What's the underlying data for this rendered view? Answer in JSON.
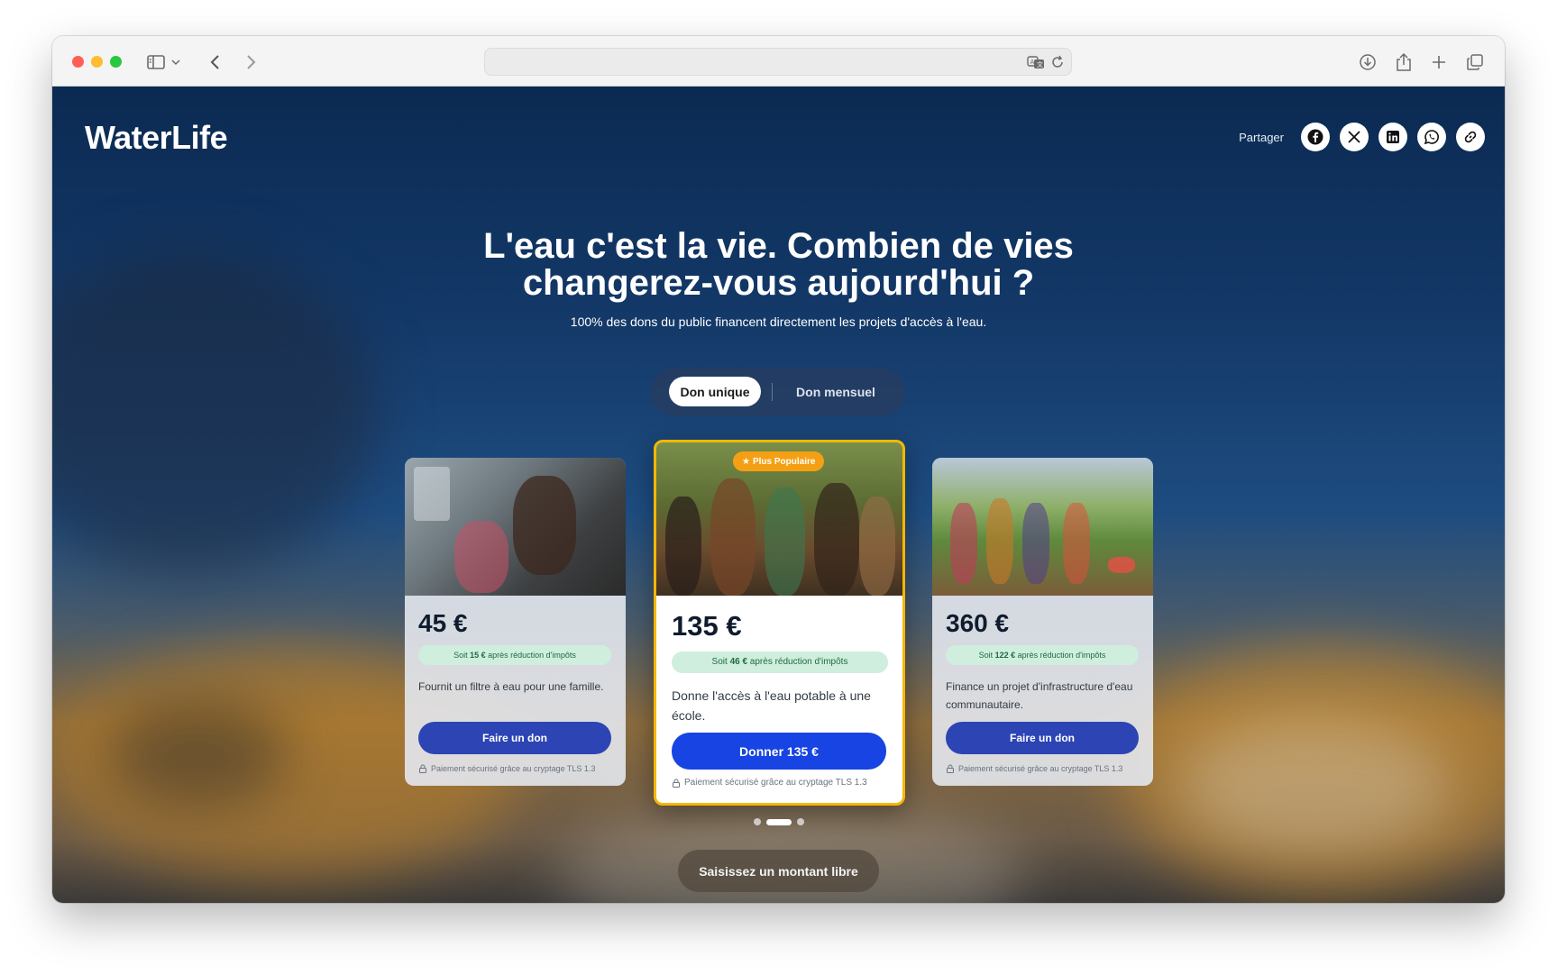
{
  "browser": {
    "url": ""
  },
  "header": {
    "logo": "WaterLife",
    "share_label": "Partager",
    "share_icons": [
      "facebook-icon",
      "x-icon",
      "linkedin-icon",
      "whatsapp-icon",
      "link-icon"
    ]
  },
  "hero": {
    "headline_line1": "L'eau c'est la vie. Combien de vies",
    "headline_line2": "changerez-vous aujourd'hui ?",
    "subheadline": "100% des dons du public financent directement les projets d'accès à l'eau."
  },
  "frequency": {
    "active": "Don unique",
    "other": "Don mensuel"
  },
  "cards": [
    {
      "price": "45 €",
      "tax_prefix": "Soit ",
      "tax_amount": "15 €",
      "tax_suffix": " après réduction d'impôts",
      "description": "Fournit un filtre à eau pour une famille.",
      "cta": "Faire un don",
      "secure": "Paiement sécurisé grâce au cryptage TLS 1.3"
    },
    {
      "badge": "Plus Populaire",
      "price": "135 €",
      "tax_prefix": "Soit ",
      "tax_amount": "46 €",
      "tax_suffix": " après réduction d'impôts",
      "description": "Donne l'accès à l'eau potable à une école.",
      "cta": "Donner 135 €",
      "secure": "Paiement sécurisé grâce au cryptage TLS 1.3"
    },
    {
      "price": "360 €",
      "tax_prefix": "Soit ",
      "tax_amount": "122 €",
      "tax_suffix": " après réduction d'impôts",
      "description": "Finance un projet d'infrastructure d'eau communautaire.",
      "cta": "Faire un don",
      "secure": "Paiement sécurisé grâce au cryptage TLS 1.3"
    }
  ],
  "carousel": {
    "count": 3,
    "active_index": 1
  },
  "free_amount_button": "Saisissez un montant libre",
  "colors": {
    "primary_button": "#1744e2",
    "secondary_button": "#2c44b4",
    "highlight_border": "#f5b700",
    "badge": "#f5a014",
    "tax_badge_bg": "#cfeedd",
    "tax_badge_text": "#1f6b3f"
  }
}
